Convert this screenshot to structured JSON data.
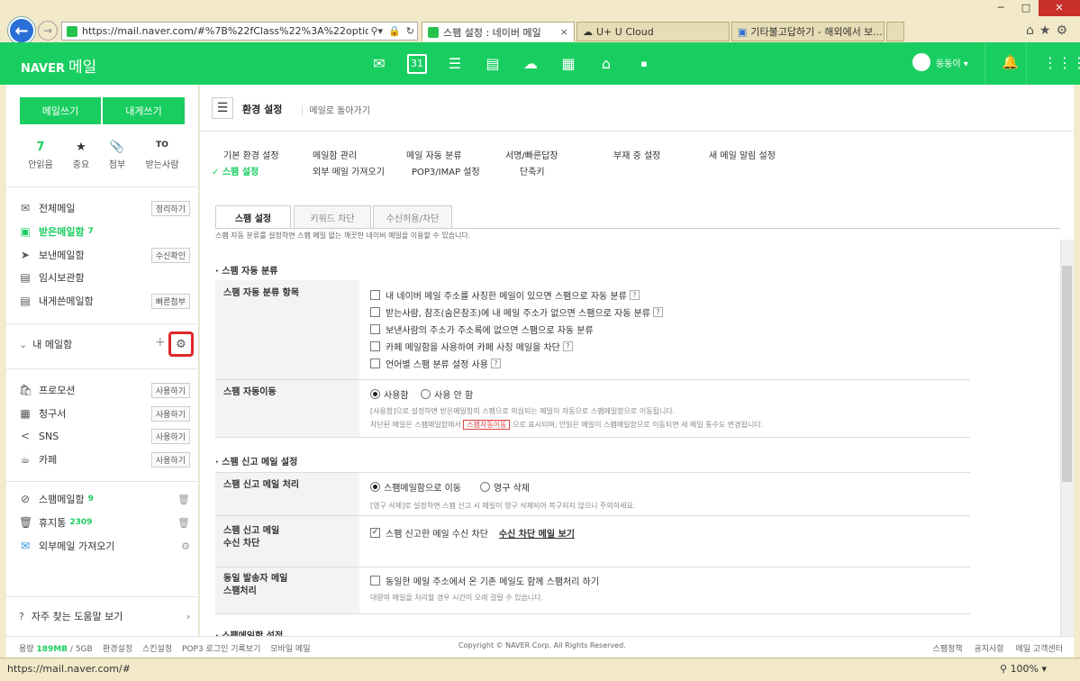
{
  "browser": {
    "back_icon": "back-arrow-icon",
    "url": "https://mail.naver.com/#%7B%22fClass%22%3A%22option%22%2C",
    "tabs": [
      {
        "title": "스팸 설정 : 네이버 메일",
        "close": "×"
      },
      {
        "title": "U+ U Cloud"
      },
      {
        "title": "기타불고답하기 - 해외에서 보..."
      }
    ],
    "window_buttons": [
      "─",
      "□",
      "✕"
    ],
    "status_url": "https://mail.naver.com/#",
    "zoom": "100%"
  },
  "header": {
    "logo": "NAVER",
    "product": "메일",
    "user": "동동이 ▾",
    "apps": [
      "mail-icon",
      "calendar-icon",
      "contacts-list-icon",
      "address-book-icon",
      "cloud-icon",
      "memo-icon",
      "home-icon",
      "more-icon"
    ]
  },
  "sidebar": {
    "write": "메일쓰기",
    "write_self": "내게쓰기",
    "quick": [
      {
        "icon": "7",
        "label": "안읽음"
      },
      {
        "icon": "★",
        "label": "중요"
      },
      {
        "icon": "📎",
        "label": "첨부"
      },
      {
        "icon": "TO",
        "label": "받는사람"
      }
    ],
    "folders": [
      {
        "icon": "✉",
        "label": "전체메일",
        "action": "정리하기"
      },
      {
        "icon": "▣",
        "label": "받은메일함",
        "count": "7"
      },
      {
        "icon": "➤",
        "label": "보낸메일함",
        "action": "수신확인"
      },
      {
        "icon": "▤",
        "label": "임시보관함"
      },
      {
        "icon": "▤",
        "label": "내게쓴메일함",
        "action": "빠른첨부"
      }
    ],
    "my_mailbox": "내 메일함",
    "smart": [
      {
        "icon": "🛍",
        "label": "프로모션",
        "action": "사용하기"
      },
      {
        "icon": "▦",
        "label": "청구서",
        "action": "사용하기"
      },
      {
        "icon": "<",
        "label": "SNS",
        "action": "사용하기"
      },
      {
        "icon": "☕",
        "label": "카페",
        "action": "사용하기"
      }
    ],
    "bottom": [
      {
        "icon": "⊘",
        "label": "스팸메일함",
        "count": "9"
      },
      {
        "icon": "🗑",
        "label": "휴지통",
        "count": "2309"
      },
      {
        "icon": "✉",
        "label": "외부메일 가져오기"
      }
    ],
    "help": "자주 찾는 도움말 보기"
  },
  "settings": {
    "title": "환경 설정",
    "back": "메일로 돌아가기",
    "links_row1": [
      "기본 환경 설정",
      "메일함 관리",
      "메일 자동 분류",
      "서명/빠른답장",
      "부재 중 설정",
      "새 메일 알림 설정"
    ],
    "links_row2": [
      "✓ 스팸 설정",
      "외부 메일 가져오기",
      "POP3/IMAP 설정",
      "단축키"
    ],
    "tabs": [
      "스팸 설정",
      "키워드 차단",
      "수신허용/차단"
    ],
    "description": "스팸 자동 분류를 설정하면 스팸 메일 없는 깨끗한 네이버 메일을 이용할 수 있습니다.",
    "sec1": "· 스팸 자동 분류",
    "auto_label": "스팸 자동 분류 항목",
    "auto_items": [
      "내 네이버 메일 주소를 사칭한 메일이 있으면 스팸으로 자동 분류",
      "받는사람, 참조(숨은참조)에 내 메일 주소가 없으면 스팸으로 자동 분류",
      "보낸사람의 주소가 주소록에 없으면 스팸으로 자동 분류",
      "카페 메일함을 사용하여 카페 사칭 메일을 차단",
      "언어별 스팸 분류 설정 사용"
    ],
    "move_label": "스팸 자동이동",
    "move_on": "사용함",
    "move_off": "사용 안 함",
    "move_note1": "[사용함]으로 설정하면 받은메일함의 스팸으로 의심되는 메일이 자동으로 스팸메일함으로 이동됩니다.",
    "move_note2a": "차단된 메일은 스팸메일함에서",
    "move_badge": "스팸자동이동",
    "move_note2b": "으로 표시되며, 안읽은 메일이 스팸메일함으로 이동되면 새 메일 통수도 변경됩니다.",
    "sec2": "· 스팸 신고 메일 설정",
    "report_label": "스팸 신고 메일 처리",
    "report_opt1": "스팸메일함으로 이동",
    "report_opt2": "영구 삭제",
    "report_note": "[영구 삭제]로 설정하면 스팸 신고 시 메일이 영구 삭제되어 복구되지 않으니 주의하세요.",
    "block_label1": "스팸 신고 메일",
    "block_label2": "수신 차단",
    "block_item": "스팸 신고한 메일 수신 차단",
    "block_link": "수신 차단 메일 보기",
    "same_label1": "동일 발송자 메일",
    "same_label2": "스팸처리",
    "same_item": "동일한 메일 주소에서 온 기존 메일도 함께 스팸처리 하기",
    "same_note": "대량의 메일을 처리할 경우 시간이 오래 걸릴 수 있습니다.",
    "sec3": "· 스팸메일함 설정"
  },
  "footer": {
    "usage_label": "용량",
    "usage": "189MB",
    "total": "/ 5GB",
    "links": [
      "환경설정",
      "스킨설정",
      "POP3 로그인 기록보기",
      "모바일 메일"
    ],
    "copyright": "Copyright © NAVER Corp. All Rights Reserved.",
    "right": [
      "스팸정책",
      "공지사항",
      "메일 고객센터"
    ]
  }
}
